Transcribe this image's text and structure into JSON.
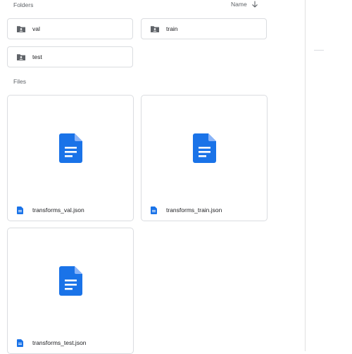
{
  "sections": {
    "folders_label": "Folders",
    "files_label": "Files"
  },
  "sort": {
    "label": "Name",
    "direction_icon": "arrow-down-icon"
  },
  "folders": [
    {
      "name": "val",
      "icon": "shared-folder-icon"
    },
    {
      "name": "train",
      "icon": "shared-folder-icon"
    },
    {
      "name": "test",
      "icon": "shared-folder-icon"
    }
  ],
  "files": [
    {
      "name": "transforms_val.json",
      "icon": "document-icon"
    },
    {
      "name": "transforms_train.json",
      "icon": "document-icon"
    },
    {
      "name": "transforms_test.json",
      "icon": "document-icon"
    }
  ],
  "colors": {
    "doc_blue": "#1a73e8",
    "folder_gray": "#5f6368",
    "border": "#dadce0"
  }
}
